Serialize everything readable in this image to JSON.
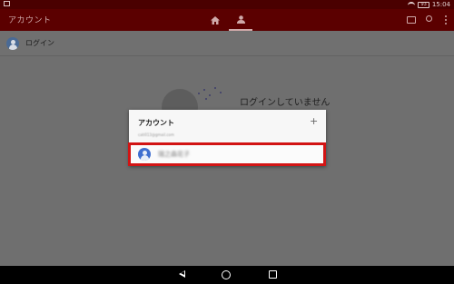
{
  "statusbar": {
    "time": "15:04",
    "battery": "93"
  },
  "appbar": {
    "title": "アカウント"
  },
  "login_row": {
    "label": "ログイン"
  },
  "background": {
    "message": "ログインしていません"
  },
  "dialog": {
    "title": "アカウント",
    "add_glyph": "+",
    "email": "cati013@gmail.com",
    "account_name": "瑞之森花子"
  },
  "colors": {
    "accent_red": "#d21414",
    "appbar_bg": "#5b0000",
    "avatar_blue": "#3f6fd0"
  }
}
